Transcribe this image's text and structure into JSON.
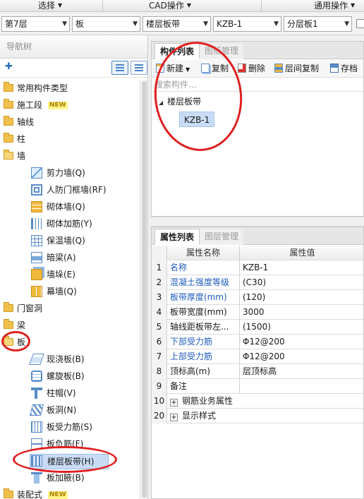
{
  "menubar": {
    "items": [
      {
        "label": "选择"
      },
      {
        "label": "CAD操作"
      },
      {
        "label": "通用操作"
      }
    ]
  },
  "selectors": {
    "floor": "第7层",
    "category": "板",
    "type": "楼层板带",
    "component": "KZB-1",
    "layer": "分层板1"
  },
  "nav": {
    "title": "导航树",
    "new_badge": "NEW",
    "tree": [
      {
        "label": "常用构件类型"
      },
      {
        "label": "施工段",
        "badge": true
      },
      {
        "label": "轴线"
      },
      {
        "label": "柱"
      },
      {
        "label": "墙"
      },
      {
        "label": "剪力墙(Q)"
      },
      {
        "label": "人防门框墙(RF)"
      },
      {
        "label": "砌体墙(Q)"
      },
      {
        "label": "砌体加筋(Y)"
      },
      {
        "label": "保温墙(Q)"
      },
      {
        "label": "暗梁(A)"
      },
      {
        "label": "墙垛(E)"
      },
      {
        "label": "幕墙(Q)"
      },
      {
        "label": "门窗洞"
      },
      {
        "label": "梁"
      },
      {
        "label": "板"
      },
      {
        "label": "现浇板(B)"
      },
      {
        "label": "螺旋板(B)"
      },
      {
        "label": "柱帽(V)"
      },
      {
        "label": "板洞(N)"
      },
      {
        "label": "板受力筋(S)"
      },
      {
        "label": "板负筋(F)"
      },
      {
        "label": "楼层板带(H)"
      },
      {
        "label": "板加腋(B)"
      },
      {
        "label": "装配式",
        "badge": true
      }
    ]
  },
  "components": {
    "tabs": [
      "构件列表",
      "图纸管理"
    ],
    "toolbar": {
      "new": "新建",
      "copy": "复制",
      "delete": "删除",
      "floor_copy": "层间复制",
      "save": "存档"
    },
    "search_placeholder": "搜索构件...",
    "root": "楼层板带",
    "selected": "KZB-1"
  },
  "properties": {
    "tabs": [
      "属性列表",
      "图层管理"
    ],
    "header_name": "属性名称",
    "header_value": "属性值",
    "rows": [
      {
        "no": "1",
        "name": "名称",
        "value": "KZB-1"
      },
      {
        "no": "2",
        "name": "混凝土强度等级",
        "value": "(C30)"
      },
      {
        "no": "3",
        "name": "板带厚度(mm)",
        "value": "(120)"
      },
      {
        "no": "4",
        "name": "板带宽度(mm)",
        "value": "3000"
      },
      {
        "no": "5",
        "name": "轴线距板带左...",
        "value": "(1500)"
      },
      {
        "no": "6",
        "name": "下部受力筋",
        "value": "Φ12@200"
      },
      {
        "no": "7",
        "name": "上部受力筋",
        "value": "Φ12@200"
      },
      {
        "no": "8",
        "name": "顶标高(m)",
        "value": "层顶标高"
      },
      {
        "no": "9",
        "name": "备注",
        "value": ""
      },
      {
        "no": "10",
        "name": "钢筋业务属性",
        "value": ""
      },
      {
        "no": "20",
        "name": "显示样式",
        "value": ""
      }
    ]
  },
  "colors": {
    "annotation": "#e02020",
    "selection": "#c9dcf5",
    "link_blue": "#1f5bbd"
  }
}
